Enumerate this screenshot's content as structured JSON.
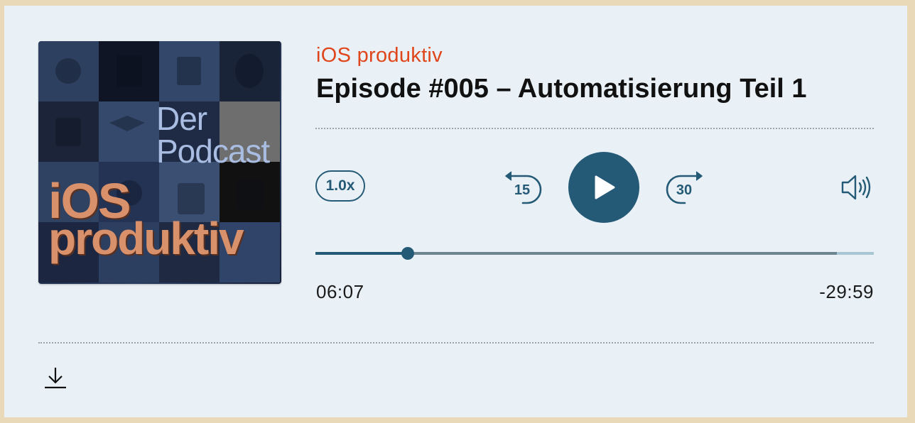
{
  "cover": {
    "line1": "Der",
    "line2": "Podcast",
    "line3": "iOS",
    "line4": "produktiv"
  },
  "show_title": "iOS produktiv",
  "episode_title": "Episode #005 – Automatisierung Teil 1",
  "controls": {
    "speed_label": "1.0x",
    "skip_back_label": "15",
    "skip_forward_label": "30",
    "play_icon": "play-icon",
    "volume_icon": "speaker-volume-icon"
  },
  "progress": {
    "played_fraction": 0.165,
    "buffered_fraction": 0.934,
    "elapsed": "06:07",
    "remaining": "-29:59"
  },
  "footer": {
    "download_icon": "download-icon"
  },
  "colors": {
    "accent": "#255a77",
    "show_title": "#e0461b",
    "card_background": "#e9f1f6",
    "page_background": "#ead9b9"
  }
}
